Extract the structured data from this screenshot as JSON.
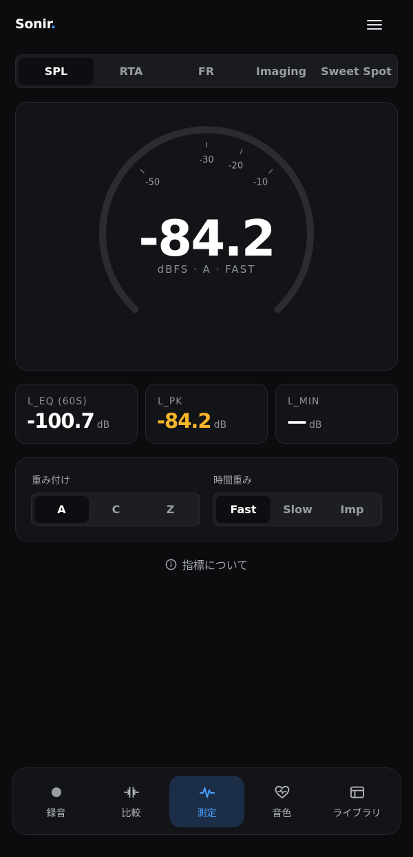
{
  "brand": {
    "name": "Sonir",
    "dot": "."
  },
  "mode_tabs": [
    {
      "label": "SPL",
      "active": true
    },
    {
      "label": "RTA",
      "active": false
    },
    {
      "label": "FR",
      "active": false
    },
    {
      "label": "Imaging",
      "active": false
    },
    {
      "label": "Sweet Spot",
      "active": false
    }
  ],
  "gauge": {
    "value": "-84.2",
    "unit_line": "dBFS · A · FAST",
    "ticks": [
      {
        "label": "-50",
        "db": -50
      },
      {
        "label": "-30",
        "db": -30
      },
      {
        "label": "-20",
        "db": -20
      },
      {
        "label": "-10",
        "db": -10
      }
    ]
  },
  "stats": [
    {
      "label": "L_EQ (60S)",
      "value": "-100.7",
      "unit": "dB",
      "accent": false
    },
    {
      "label": "L_PK",
      "value": "-84.2",
      "unit": "dB",
      "accent": true
    },
    {
      "label": "L_MIN",
      "value": "—",
      "unit": "dB",
      "accent": false
    }
  ],
  "weighting": {
    "label": "重み付け",
    "options": [
      {
        "label": "A",
        "active": true
      },
      {
        "label": "C",
        "active": false
      },
      {
        "label": "Z",
        "active": false
      }
    ]
  },
  "time_weighting": {
    "label": "時間重み",
    "options": [
      {
        "label": "Fast",
        "active": true
      },
      {
        "label": "Slow",
        "active": false
      },
      {
        "label": "Imp",
        "active": false
      }
    ]
  },
  "info_link": {
    "label": "指標について",
    "icon": "info-icon"
  },
  "bottom_nav": [
    {
      "label": "録音",
      "icon": "record-dot-icon",
      "active": false
    },
    {
      "label": "比較",
      "icon": "compare-icon",
      "active": false
    },
    {
      "label": "測定",
      "icon": "waveform-icon",
      "active": true
    },
    {
      "label": "音色",
      "icon": "heart-pulse-icon",
      "active": false
    },
    {
      "label": "ライブラリ",
      "icon": "library-icon",
      "active": false
    }
  ],
  "colors": {
    "accent": "#4aa3ff",
    "peak": "#f6b52a",
    "background": "#0b0c0e",
    "card": "#131417"
  }
}
